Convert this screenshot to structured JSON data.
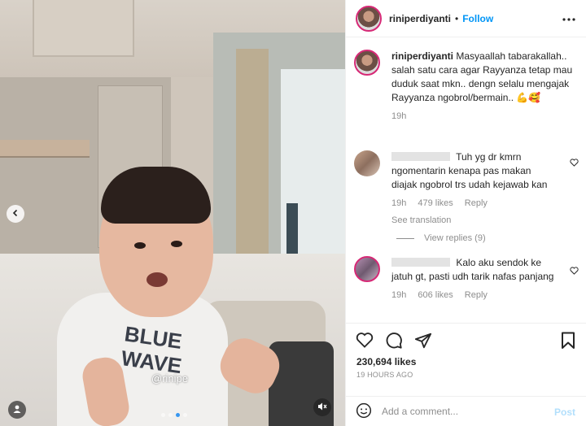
{
  "header": {
    "username": "riniperdiyanti",
    "separator": "•",
    "follow_label": "Follow",
    "more_icon": "more-horizontal-icon"
  },
  "media": {
    "shirt_print": "BLUE WAVE",
    "watermark": "@rinipe",
    "prev_icon": "chevron-left-icon",
    "user_icon": "user-tag-icon",
    "mute_icon": "speaker-muted-icon",
    "carousel_total": 4,
    "carousel_active": 2
  },
  "caption": {
    "username": "riniperdiyanti",
    "text": "Masyaallah tabarakallah.. salah satu cara agar Rayyanza tetap mau duduk saat mkn.. dengn selalu mengajak Rayyanza ngobrol/bermain.. 💪🥰",
    "age": "19h"
  },
  "comments": [
    {
      "text": "Tuh yg dr kmrn ngomentarin kenapa pas makan diajak ngobrol trs udah kejawab kan",
      "age": "19h",
      "likes": "479 likes",
      "reply": "Reply",
      "see_translation": "See translation",
      "view_replies": "View replies (9)"
    },
    {
      "text": "Kalo aku sendok ke jatuh gt, pasti udh tarik nafas panjang",
      "age": "19h",
      "likes": "606 likes",
      "reply": "Reply"
    }
  ],
  "actions": {
    "likes": "230,694 likes",
    "timestamp": "19 HOURS AGO"
  },
  "add_comment": {
    "placeholder": "Add a comment...",
    "post_label": "Post",
    "emoji_icon": "emoji-icon"
  },
  "colors": {
    "follow": "#0095f6",
    "post_disabled": "#b2dffc",
    "muted": "#8e8e8e"
  }
}
